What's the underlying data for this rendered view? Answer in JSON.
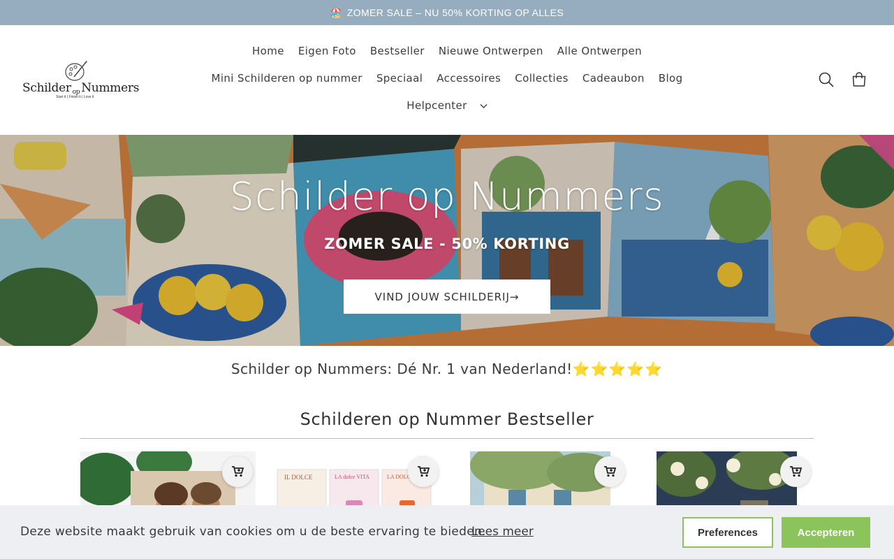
{
  "announcement": {
    "icon": "beach-umbrella-icon",
    "text": "ZOMER SALE – NU 50% KORTING OP ALLES"
  },
  "logo": {
    "brand_left": "Schilder",
    "brand_op": "op",
    "brand_right": "Nummers",
    "tagline": "Start it | Finish it | Love it"
  },
  "nav": {
    "row1": [
      "Home",
      "Eigen Foto",
      "Bestseller",
      "Nieuwe Ontwerpen",
      "Alle Ontwerpen"
    ],
    "row2": [
      "Mini Schilderen op nummer",
      "Speciaal",
      "Accessoires",
      "Collecties",
      "Cadeaubon",
      "Blog"
    ],
    "row3": [
      "Helpcenter"
    ]
  },
  "header_icons": {
    "search": "search-icon",
    "cart": "cart-icon"
  },
  "hero": {
    "title": "Schilder op Nummers",
    "subtitle": "ZOMER SALE - 50% KORTING",
    "button": "VIND JOUW SCHILDERIJ→"
  },
  "tagline": {
    "text": "Schilder op Nummers: Dé Nr. 1 van Nederland!",
    "stars": "⭐⭐⭐⭐⭐"
  },
  "bestseller": {
    "title": "Schilderen op Nummer Bestseller"
  },
  "products": [
    {
      "image": "couple-photo-with-palm-leaves",
      "button": "add-to-cart-icon"
    },
    {
      "image": "il-dolce-vita-prints",
      "button": "add-to-cart-icon",
      "labels": [
        "IL DOLCE",
        "LA dolce VITA",
        "LA DOLCE"
      ]
    },
    {
      "image": "italian-house-with-tree",
      "button": "add-to-cart-icon"
    },
    {
      "image": "wine-glasses-with-flowers",
      "button": "add-to-cart-icon"
    }
  ],
  "cookie": {
    "text": "Deze website maakt gebruik van cookies om u de beste ervaring te bieden.",
    "link": "Lees meer",
    "preferences": "Preferences",
    "accept": "Accepteren"
  },
  "colors": {
    "announcement_bg": "#95adbf",
    "accept_green": "#8ac45a",
    "cookie_bg": "#edeff2"
  }
}
